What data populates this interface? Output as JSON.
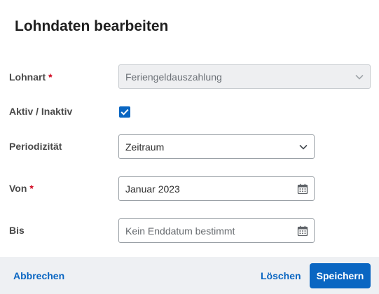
{
  "dialog": {
    "title": "Lohndaten bearbeiten"
  },
  "form": {
    "lohnart": {
      "label": "Lohnart",
      "required_mark": "*",
      "value": "Feriengeldauszahlung",
      "disabled": true
    },
    "aktiv": {
      "label": "Aktiv / Inaktiv",
      "checked": true
    },
    "periodizitaet": {
      "label": "Periodizität",
      "value": "Zeitraum"
    },
    "von": {
      "label": "Von",
      "required_mark": "*",
      "value": "Januar 2023"
    },
    "bis": {
      "label": "Bis",
      "placeholder": "Kein Enddatum bestimmt"
    }
  },
  "footer": {
    "cancel_label": "Abbrechen",
    "delete_label": "Löschen",
    "save_label": "Speichern"
  },
  "colors": {
    "accent": "#0a66c2",
    "required": "#d0021b",
    "footer_bg": "#eef0f3"
  },
  "icons": {
    "select": "chevron-down-icon",
    "date": "calendar-icon",
    "checkbox": "checkmark-icon"
  }
}
